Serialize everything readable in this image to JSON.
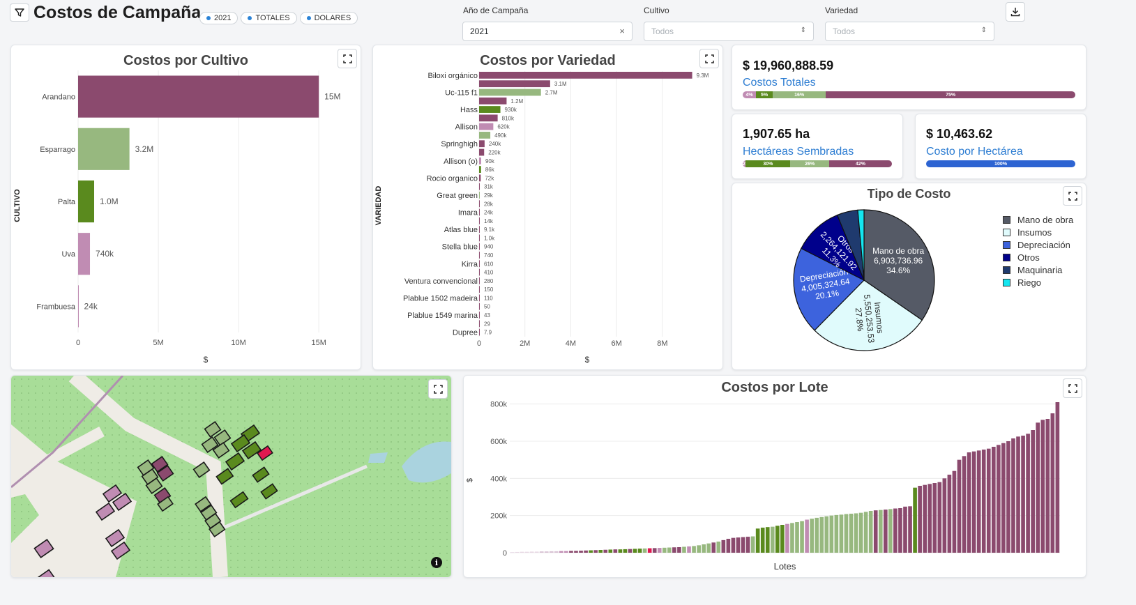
{
  "header": {
    "title": "Costos de Campaña",
    "chips": [
      "2021",
      "TOTALES",
      "DOLARES"
    ]
  },
  "filters": {
    "year": {
      "label": "Año de Campaña",
      "value": "2021"
    },
    "crop": {
      "label": "Cultivo",
      "placeholder": "Todos"
    },
    "variety": {
      "label": "Variedad",
      "placeholder": "Todos"
    }
  },
  "colors": {
    "arandano": "#8b4a6e",
    "esparrago": "#97b87f",
    "palta": "#5a8a1e",
    "uva": "#c08cb3",
    "blue": "#2d7dd2"
  },
  "kpis": {
    "total": {
      "value": "$ 19,960,888.59",
      "label": "Costos Totales",
      "segments": [
        {
          "pct": 4,
          "label": "4%",
          "color": "#c08cb3"
        },
        {
          "pct": 5,
          "label": "5%",
          "color": "#5a8a1e"
        },
        {
          "pct": 16,
          "label": "16%",
          "color": "#97b87f"
        },
        {
          "pct": 75,
          "label": "75%",
          "color": "#8b4a6e"
        }
      ]
    },
    "hectares": {
      "value": "1,907.65 ha",
      "label": "Hectáreas Sembradas",
      "segments": [
        {
          "pct": 2,
          "label": "2",
          "color": "#c08cb3"
        },
        {
          "pct": 30,
          "label": "30%",
          "color": "#5a8a1e"
        },
        {
          "pct": 26,
          "label": "26%",
          "color": "#97b87f"
        },
        {
          "pct": 42,
          "label": "42%",
          "color": "#8b4a6e"
        }
      ]
    },
    "per_hectare": {
      "value": "$ 10,463.62",
      "label": "Costo por Hectárea",
      "segments": [
        {
          "pct": 100,
          "label": "100%",
          "color": "#2d64d2"
        }
      ]
    }
  },
  "charts": {
    "cultivo": {
      "title": "Costos por Cultivo",
      "chart_data": {
        "type": "bar",
        "orientation": "horizontal",
        "categories": [
          "Arandano",
          "Esparrago",
          "Palta",
          "Uva",
          "Frambuesa"
        ],
        "values": [
          15000000,
          3200000,
          1000000,
          740000,
          24000
        ],
        "value_labels": [
          "15M",
          "3.2M",
          "1.0M",
          "740k",
          "24k"
        ],
        "colors": [
          "#8b4a6e",
          "#97b87f",
          "#5a8a1e",
          "#c08cb3",
          "#c08cb3"
        ],
        "xlabel": "$",
        "ylabel": "CULTIVO",
        "xlim": [
          0,
          16600000
        ],
        "xticks": [
          0,
          5000000,
          10000000,
          15000000
        ],
        "xtick_labels": [
          "0",
          "5M",
          "10M",
          "15M"
        ]
      }
    },
    "variedad": {
      "title": "Costos por Variedad",
      "chart_data": {
        "type": "bar",
        "orientation": "horizontal",
        "categories": [
          "Biloxi orgánico",
          "",
          "Uc-115 f1",
          "",
          "Hass",
          "",
          "Allison",
          "",
          "Springhigh",
          "",
          "Allison (o)",
          "",
          "Rocio organico",
          "",
          "Great green",
          "",
          "Imara",
          "",
          "Atlas blue",
          "",
          "Stella blue",
          "",
          "Kirra",
          "",
          "Ventura convencional",
          "",
          "Plablue 1502 madeira",
          "",
          "Plablue 1549 marina",
          "",
          "Dupree"
        ],
        "values": [
          9300000,
          3100000,
          2700000,
          1200000,
          930000,
          810000,
          620000,
          490000,
          240000,
          220000,
          90000,
          86000,
          72000,
          31000,
          29000,
          28000,
          24000,
          14000,
          9100,
          1000,
          940,
          740,
          610,
          410,
          280,
          150,
          110,
          50,
          43,
          29,
          7.9
        ],
        "value_labels": [
          "9.3M",
          "3.1M",
          "2.7M",
          "1.2M",
          "930k",
          "810k",
          "620k",
          "490k",
          "240k",
          "220k",
          "90k",
          "86k",
          "72k",
          "31k",
          "29k",
          "28k",
          "24k",
          "14k",
          "9.1k",
          "1.0k",
          "940",
          "740",
          "610",
          "410",
          "280",
          "150",
          "110",
          "50",
          "43",
          "29",
          "7.9"
        ],
        "colors": [
          "#8b4a6e",
          "#8b4a6e",
          "#97b87f",
          "#8b4a6e",
          "#5a8a1e",
          "#8b4a6e",
          "#c08cb3",
          "#97b87f",
          "#8b4a6e",
          "#8b4a6e",
          "#c08cb3",
          "#5a8a1e",
          "#8b4a6e",
          "#8b4a6e",
          "#97b87f",
          "#8b4a6e",
          "#8b4a6e",
          "#8b4a6e",
          "#8b4a6e",
          "#8b4a6e",
          "#8b4a6e",
          "#8b4a6e",
          "#8b4a6e",
          "#8b4a6e",
          "#8b4a6e",
          "#8b4a6e",
          "#8b4a6e",
          "#8b4a6e",
          "#8b4a6e",
          "#8b4a6e",
          "#8b4a6e"
        ],
        "xlabel": "$",
        "ylabel": "VARIEDAD",
        "xlim": [
          0,
          9800000
        ],
        "xticks": [
          0,
          2000000,
          4000000,
          6000000,
          8000000
        ],
        "xtick_labels": [
          "0",
          "2M",
          "4M",
          "6M",
          "8M"
        ]
      }
    },
    "tipo": {
      "title": "Tipo de Costo",
      "chart_data": {
        "type": "pie",
        "labels": [
          "Mano de obra",
          "Insumos",
          "Depreciación",
          "Otros",
          "Maquinaria",
          "Riego"
        ],
        "values": [
          6903736.96,
          5550253.53,
          4005324.64,
          2264121.92,
          953451.54,
          284000
        ],
        "value_labels": [
          "6,903,736.96",
          "5,550,253.53",
          "4,005,324.64",
          "2,264,121.92",
          "",
          ""
        ],
        "pct_labels": [
          "34.6%",
          "27.8%",
          "20.1%",
          "11.3%",
          "",
          ""
        ],
        "colors": [
          "#555a66",
          "#e0fbfc",
          "#3d63dd",
          "#00008b",
          "#1f3a6e",
          "#14e6f0"
        ],
        "legend": "right"
      }
    },
    "lote": {
      "title": "Costos por Lote",
      "chart_data": {
        "type": "bar",
        "xlabel": "Lotes",
        "ylabel": "$",
        "ylim": [
          0,
          840000
        ],
        "yticks": [
          0,
          200000,
          400000,
          600000,
          800000
        ],
        "ytick_labels": [
          "0",
          "200k",
          "400k",
          "600k",
          "800k"
        ],
        "values": [
          3000,
          4000,
          5000,
          5000,
          6000,
          6000,
          7000,
          7000,
          8000,
          8000,
          9000,
          9000,
          10000,
          10000,
          11000,
          12000,
          13000,
          14000,
          15000,
          16000,
          17000,
          18000,
          18000,
          19000,
          20000,
          21000,
          22000,
          23000,
          24000,
          25000,
          26000,
          27000,
          28000,
          29000,
          30000,
          32000,
          34000,
          36000,
          40000,
          45000,
          50000,
          55000,
          60000,
          68000,
          75000,
          80000,
          82000,
          84000,
          86000,
          88000,
          130000,
          135000,
          138000,
          140000,
          145000,
          150000,
          155000,
          160000,
          165000,
          170000,
          178000,
          183000,
          188000,
          192000,
          196000,
          200000,
          203000,
          205000,
          208000,
          210000,
          212000,
          215000,
          220000,
          225000,
          228000,
          230000,
          232000,
          235000,
          238000,
          240000,
          248000,
          250000,
          350000,
          360000,
          365000,
          370000,
          375000,
          380000,
          400000,
          420000,
          440000,
          500000,
          520000,
          540000,
          545000,
          550000,
          555000,
          560000,
          570000,
          580000,
          590000,
          600000,
          615000,
          625000,
          630000,
          640000,
          660000,
          700000,
          715000,
          720000,
          750000,
          810000
        ],
        "colors": [
          "#e8d8e4",
          "#e8d8e4",
          "#e8d8e4",
          "#e8d8e4",
          "#e8d8e4",
          "#e8d8e4",
          "#d9c3d4",
          "#d9c3d4",
          "#d9c3d4",
          "#d9c3d4",
          "#c08cb3",
          "#c08cb3",
          "#8b4a6e",
          "#8b4a6e",
          "#8b4a6e",
          "#8b4a6e",
          "#5a8a1e",
          "#8b4a6e",
          "#5a8a1e",
          "#8b4a6e",
          "#5a8a1e",
          "#8b4a6e",
          "#5a8a1e",
          "#5a8a1e",
          "#8b4a6e",
          "#5a8a1e",
          "#5a8a1e",
          "#97b87f",
          "#e01850",
          "#8b4a6e",
          "#c08cb3",
          "#97b87f",
          "#97b87f",
          "#8b4a6e",
          "#8b4a6e",
          "#97b87f",
          "#c08cb3",
          "#97b87f",
          "#97b87f",
          "#97b87f",
          "#97b87f",
          "#8b4a6e",
          "#97b87f",
          "#8b4a6e",
          "#8b4a6e",
          "#8b4a6e",
          "#8b4a6e",
          "#8b4a6e",
          "#8b4a6e",
          "#97b87f",
          "#5a8a1e",
          "#5a8a1e",
          "#5a8a1e",
          "#97b87f",
          "#5a8a1e",
          "#5a8a1e",
          "#c08cb3",
          "#97b87f",
          "#97b87f",
          "#97b87f",
          "#c08cb3",
          "#97b87f",
          "#97b87f",
          "#97b87f",
          "#97b87f",
          "#97b87f",
          "#97b87f",
          "#97b87f",
          "#97b87f",
          "#97b87f",
          "#97b87f",
          "#97b87f",
          "#97b87f",
          "#97b87f",
          "#8b4a6e",
          "#97b87f",
          "#8b4a6e",
          "#97b87f",
          "#8b4a6e",
          "#8b4a6e",
          "#8b4a6e",
          "#8b4a6e",
          "#5a8a1e",
          "#8b4a6e",
          "#8b4a6e",
          "#8b4a6e",
          "#8b4a6e",
          "#8b4a6e",
          "#8b4a6e",
          "#8b4a6e",
          "#8b4a6e",
          "#8b4a6e",
          "#8b4a6e",
          "#8b4a6e",
          "#8b4a6e",
          "#8b4a6e",
          "#8b4a6e",
          "#8b4a6e",
          "#8b4a6e",
          "#8b4a6e",
          "#8b4a6e",
          "#8b4a6e",
          "#8b4a6e",
          "#8b4a6e",
          "#8b4a6e",
          "#8b4a6e",
          "#8b4a6e",
          "#8b4a6e",
          "#8b4a6e",
          "#8b4a6e",
          "#8b4a6e",
          "#8b4a6e",
          "#8b4a6e",
          "#8b4a6e"
        ]
      }
    }
  },
  "map": {
    "plots": [
      {
        "color": "#97b87f"
      },
      {
        "color": "#5a8a1e"
      },
      {
        "color": "#8b4a6e"
      },
      {
        "color": "#c08cb3"
      },
      {
        "color": "#e01850"
      }
    ]
  }
}
